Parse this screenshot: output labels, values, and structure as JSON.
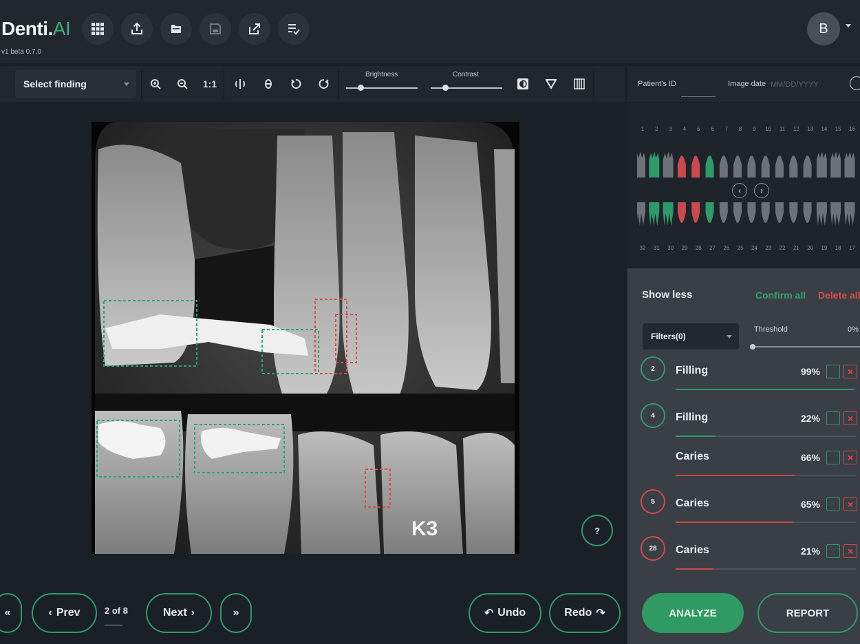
{
  "app": {
    "logo_main": "Denti.",
    "logo_accent": "AI",
    "version": "v1 beta 0.7.0",
    "user_initial": "B"
  },
  "header_tools": [
    "grid-icon",
    "upload-icon",
    "folder-icon",
    "save-icon",
    "share-icon",
    "checklist-icon"
  ],
  "toolbar": {
    "select_finding": "Select finding",
    "zoom_1to1": "1:1",
    "brightness_label": "Brightness",
    "contrast_label": "Contrast",
    "brightness_level": 0.2,
    "contrast_level": 0.2
  },
  "patient": {
    "id_label": "Patient's ID",
    "id_value": "",
    "date_label": "Image date",
    "date_placeholder": "MM/DD/YYYY"
  },
  "tooth_chart": {
    "upper_numbers": [
      "1",
      "2",
      "3",
      "4",
      "5",
      "6",
      "7",
      "8",
      "9",
      "10",
      "11",
      "12",
      "13",
      "14",
      "15",
      "16"
    ],
    "lower_numbers": [
      "32",
      "31",
      "30",
      "29",
      "28",
      "27",
      "26",
      "25",
      "24",
      "23",
      "22",
      "21",
      "20",
      "19",
      "18",
      "17"
    ],
    "colors": {
      "green": "#2f9a6a",
      "red": "#c94a4f",
      "gray": "#6c7278"
    }
  },
  "findings_panel": {
    "show_less": "Show less",
    "confirm_all": "Confirm all",
    "delete_all": "Delete all",
    "filters": "Filters(0)",
    "threshold_label": "Threshold",
    "threshold_value": "0%",
    "items": [
      {
        "tooth": "2",
        "name": "Filling",
        "pct": "99%",
        "level": 0.99,
        "color": "green"
      },
      {
        "tooth": "4",
        "name": "Filling",
        "pct": "22%",
        "level": 0.22,
        "color": "green"
      },
      {
        "tooth": "",
        "name": "Caries",
        "pct": "66%",
        "level": 0.66,
        "color": "red"
      },
      {
        "tooth": "5",
        "name": "Caries",
        "pct": "65%",
        "level": 0.65,
        "color": "red"
      },
      {
        "tooth": "28",
        "name": "Caries",
        "pct": "21%",
        "level": 0.21,
        "color": "red"
      }
    ],
    "analyze": "ANALYZE",
    "report": "REPORT"
  },
  "viewer": {
    "film_label": "K3",
    "help": "?"
  },
  "nav": {
    "prev": "Prev",
    "next": "Next",
    "page": "2 of 8",
    "undo": "Undo",
    "redo": "Redo"
  }
}
